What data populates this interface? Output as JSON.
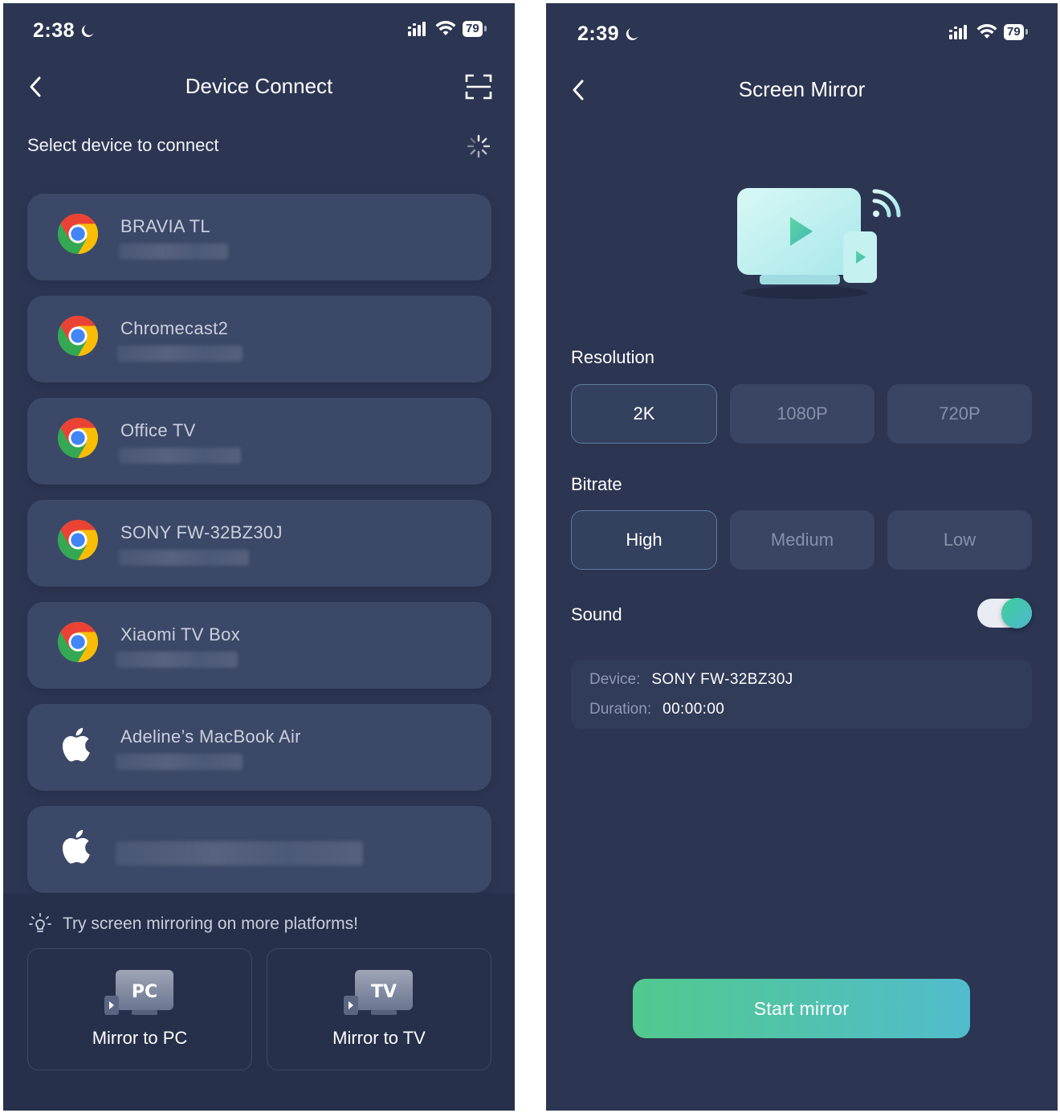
{
  "left": {
    "status": {
      "time": "2:38",
      "battery": "79"
    },
    "header": {
      "title": "Device Connect"
    },
    "subtitle": "Select device to connect",
    "devices": [
      {
        "name": "BRAVIA TL",
        "icon": "chrome-icon"
      },
      {
        "name": "Chromecast2",
        "icon": "chrome-icon"
      },
      {
        "name": "Office TV",
        "icon": "chrome-icon"
      },
      {
        "name": "SONY FW-32BZ30J",
        "icon": "chrome-icon"
      },
      {
        "name": "Xiaomi TV Box",
        "icon": "chrome-icon"
      },
      {
        "name": "Adeline’s MacBook Air",
        "icon": "apple-icon"
      },
      {
        "name": "",
        "icon": "apple-icon"
      }
    ],
    "promo": {
      "text": "Try screen mirroring on more platforms!",
      "pc": {
        "badge": "PC",
        "label": "Mirror to PC"
      },
      "tv": {
        "badge": "TV",
        "label": "Mirror to TV"
      }
    }
  },
  "right": {
    "status": {
      "time": "2:39",
      "battery": "79"
    },
    "header": {
      "title": "Screen Mirror"
    },
    "resolution": {
      "label": "Resolution",
      "options": [
        "2K",
        "1080P",
        "720P"
      ],
      "selected": "2K"
    },
    "bitrate": {
      "label": "Bitrate",
      "options": [
        "High",
        "Medium",
        "Low"
      ],
      "selected": "High"
    },
    "sound": {
      "label": "Sound",
      "enabled": true
    },
    "info": {
      "device_key": "Device:",
      "device_value": "SONY FW-32BZ30J",
      "duration_key": "Duration:",
      "duration_value": "00:00:00"
    },
    "start_button": "Start mirror"
  },
  "colors": {
    "background": "#2c3653",
    "card": "#3c4867",
    "accent_gradient_start": "#52c98e",
    "accent_gradient_end": "#52bccd"
  }
}
